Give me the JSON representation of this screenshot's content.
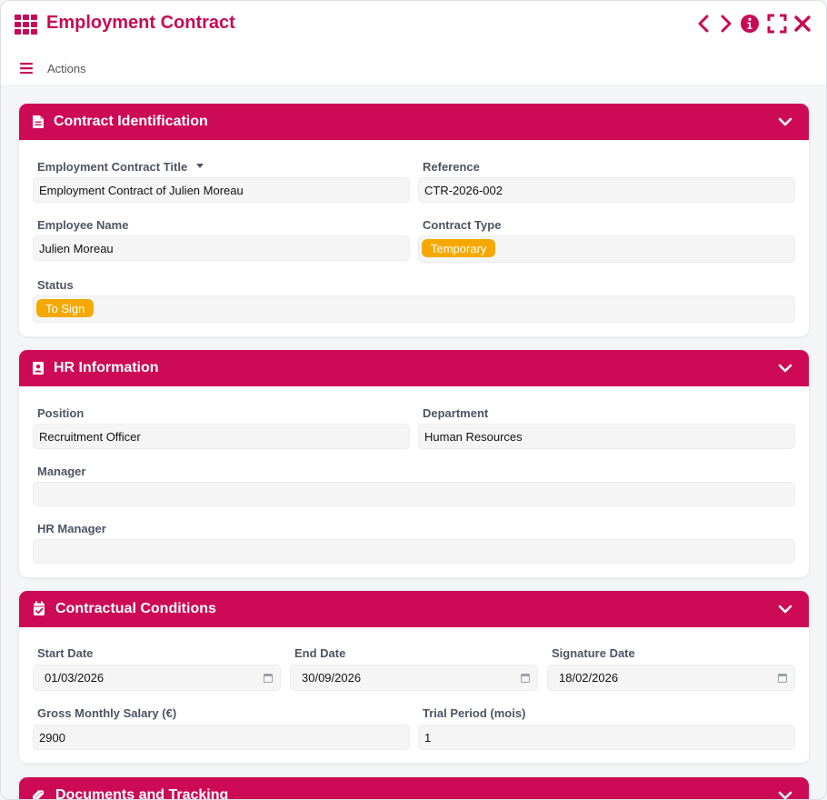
{
  "window": {
    "title": "Employment Contract"
  },
  "toolbar": {
    "actions_label": "Actions"
  },
  "icons": [
    "app-grid-icon",
    "chevron-left-icon",
    "chevron-right-icon",
    "info-icon",
    "fullscreen-icon",
    "close-icon",
    "hamburger-icon",
    "document-icon",
    "id-badge-icon",
    "calendar-check-icon",
    "paperclip-icon",
    "chevron-down-icon",
    "calendar-icon"
  ],
  "colors": {
    "accent": "#cc0a55",
    "badge": "#f5a900"
  },
  "sections": {
    "identification": {
      "title": "Contract Identification",
      "fields": {
        "contract_title": {
          "label": "Employment Contract Title",
          "value": "Employment Contract of Julien Moreau"
        },
        "reference": {
          "label": "Reference",
          "value": "CTR-2026-002"
        },
        "employee_name": {
          "label": "Employee Name",
          "value": "Julien Moreau"
        },
        "contract_type": {
          "label": "Contract Type",
          "value": "Temporary"
        },
        "status": {
          "label": "Status",
          "value": "To Sign"
        }
      }
    },
    "hr": {
      "title": "HR Information",
      "fields": {
        "position": {
          "label": "Position",
          "value": "Recruitment Officer"
        },
        "department": {
          "label": "Department",
          "value": "Human Resources"
        },
        "manager": {
          "label": "Manager",
          "value": ""
        },
        "hr_manager": {
          "label": "HR Manager",
          "value": ""
        }
      }
    },
    "conditions": {
      "title": "Contractual Conditions",
      "fields": {
        "start_date": {
          "label": "Start Date",
          "value": "01/03/2026"
        },
        "end_date": {
          "label": "End Date",
          "value": "30/09/2026"
        },
        "signature_date": {
          "label": "Signature Date",
          "value": "18/02/2026"
        },
        "gross_salary": {
          "label": "Gross Monthly Salary (€)",
          "value": "2900"
        },
        "trial_period": {
          "label": "Trial Period (mois)",
          "value": "1"
        }
      }
    },
    "documents": {
      "title": "Documents and Tracking"
    }
  }
}
